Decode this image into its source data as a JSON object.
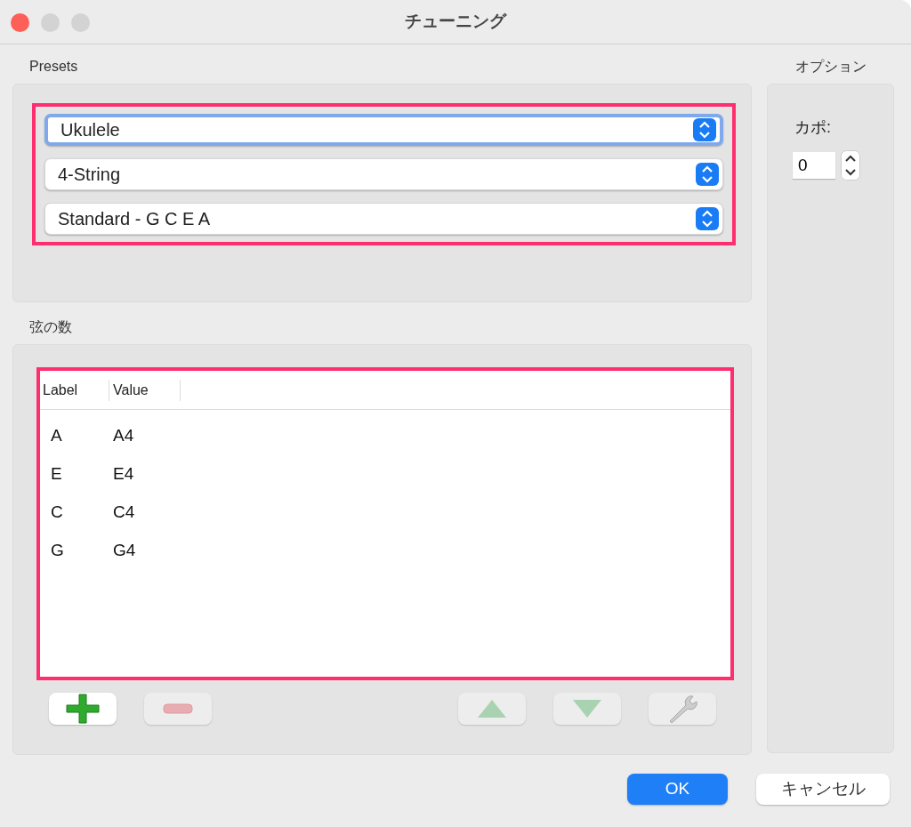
{
  "window": {
    "title": "チューニング"
  },
  "presets": {
    "title": "Presets",
    "popups": [
      {
        "value": "Ukulele",
        "focused": true
      },
      {
        "value": "4-String",
        "focused": false
      },
      {
        "value": "Standard - G C E A",
        "focused": false
      }
    ]
  },
  "strings": {
    "title": "弦の数",
    "columns": [
      "Label",
      "Value"
    ],
    "rows": [
      {
        "label": "A",
        "value": "A4"
      },
      {
        "label": "E",
        "value": "E4"
      },
      {
        "label": "C",
        "value": "C4"
      },
      {
        "label": "G",
        "value": "G4"
      }
    ],
    "tools": [
      {
        "kind": "add",
        "disabled": false
      },
      {
        "kind": "remove",
        "disabled": true
      },
      {
        "kind": "up",
        "disabled": true
      },
      {
        "kind": "down",
        "disabled": true
      },
      {
        "kind": "edit",
        "disabled": true
      }
    ]
  },
  "options": {
    "title": "オプション",
    "capo_label": "カポ:",
    "capo_value": "0"
  },
  "buttons": [
    {
      "label": "OK",
      "kind": "primary"
    },
    {
      "label": "キャンセル",
      "kind": "secondary"
    }
  ]
}
